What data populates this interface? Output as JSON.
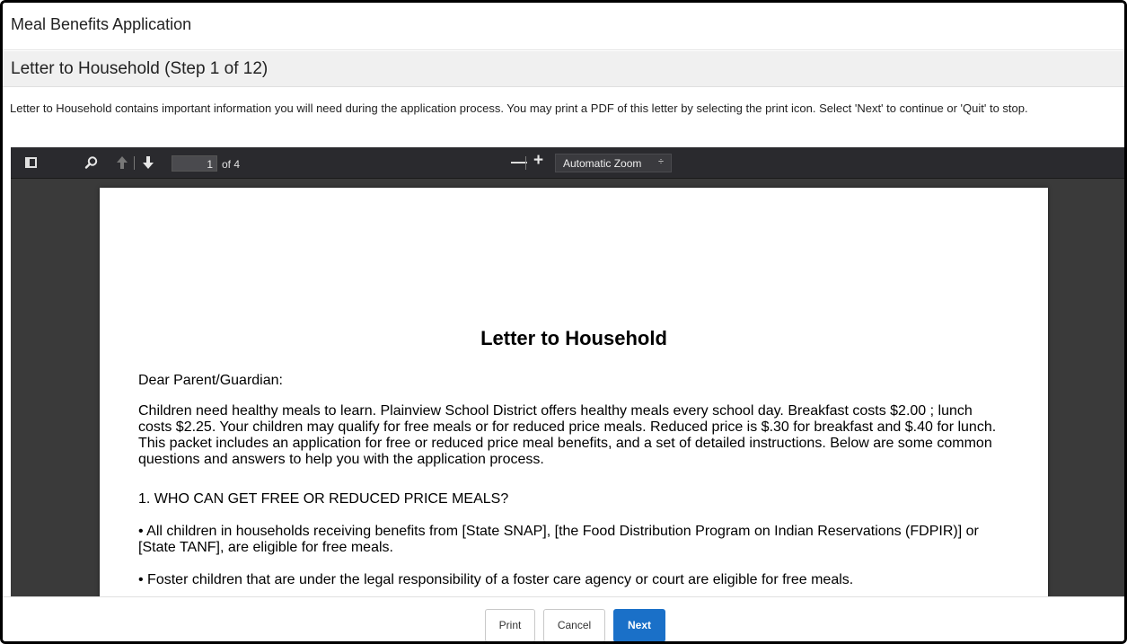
{
  "app": {
    "title": "Meal Benefits Application"
  },
  "step": {
    "heading": "Letter to Household  (Step 1 of 12)"
  },
  "instructions": "Letter to Household contains important information you will need during the application process. You may print a PDF of this letter by selecting the print icon. Select 'Next' to continue or 'Quit' to stop.",
  "viewer": {
    "toolbar": {
      "page_value": "1",
      "page_count": "of 4",
      "zoom_out": "—",
      "zoom_in": "+",
      "zoom_label": "Automatic Zoom",
      "zoom_caret": "÷"
    },
    "document": {
      "title": "Letter to Household",
      "greeting": "Dear Parent/Guardian:",
      "paragraph1": "Children need healthy meals to learn. Plainview School District offers healthy meals every school day. Breakfast costs $2.00 ; lunch costs $2.25. Your children may qualify for free meals or for reduced price meals. Reduced price is $.30 for breakfast and $.40 for lunch. This packet includes an application for free or reduced price meal benefits, and a set of detailed instructions. Below are some common questions and answers to help you with the application process.",
      "question1": "1.   WHO CAN GET FREE OR REDUCED PRICE MEALS?",
      "bullet1": "•   All children in households receiving benefits from [State SNAP], [the Food Distribution Program on Indian Reservations (FDPIR)] or [State TANF], are eligible for free meals.",
      "bullet2": "•   Foster children that are under the legal responsibility of a foster care agency or court are eligible for free meals."
    }
  },
  "footer": {
    "print_label": "Print",
    "cancel_label": "Cancel",
    "next_label": "Next"
  },
  "colors": {
    "primary": "#1a70c8",
    "toolbar": "#2a2a2e",
    "viewer_bg": "#3a3a3a"
  },
  "icons": [
    "sidebar-toggle-icon",
    "search-icon",
    "arrow-up-icon",
    "arrow-down-icon"
  ]
}
